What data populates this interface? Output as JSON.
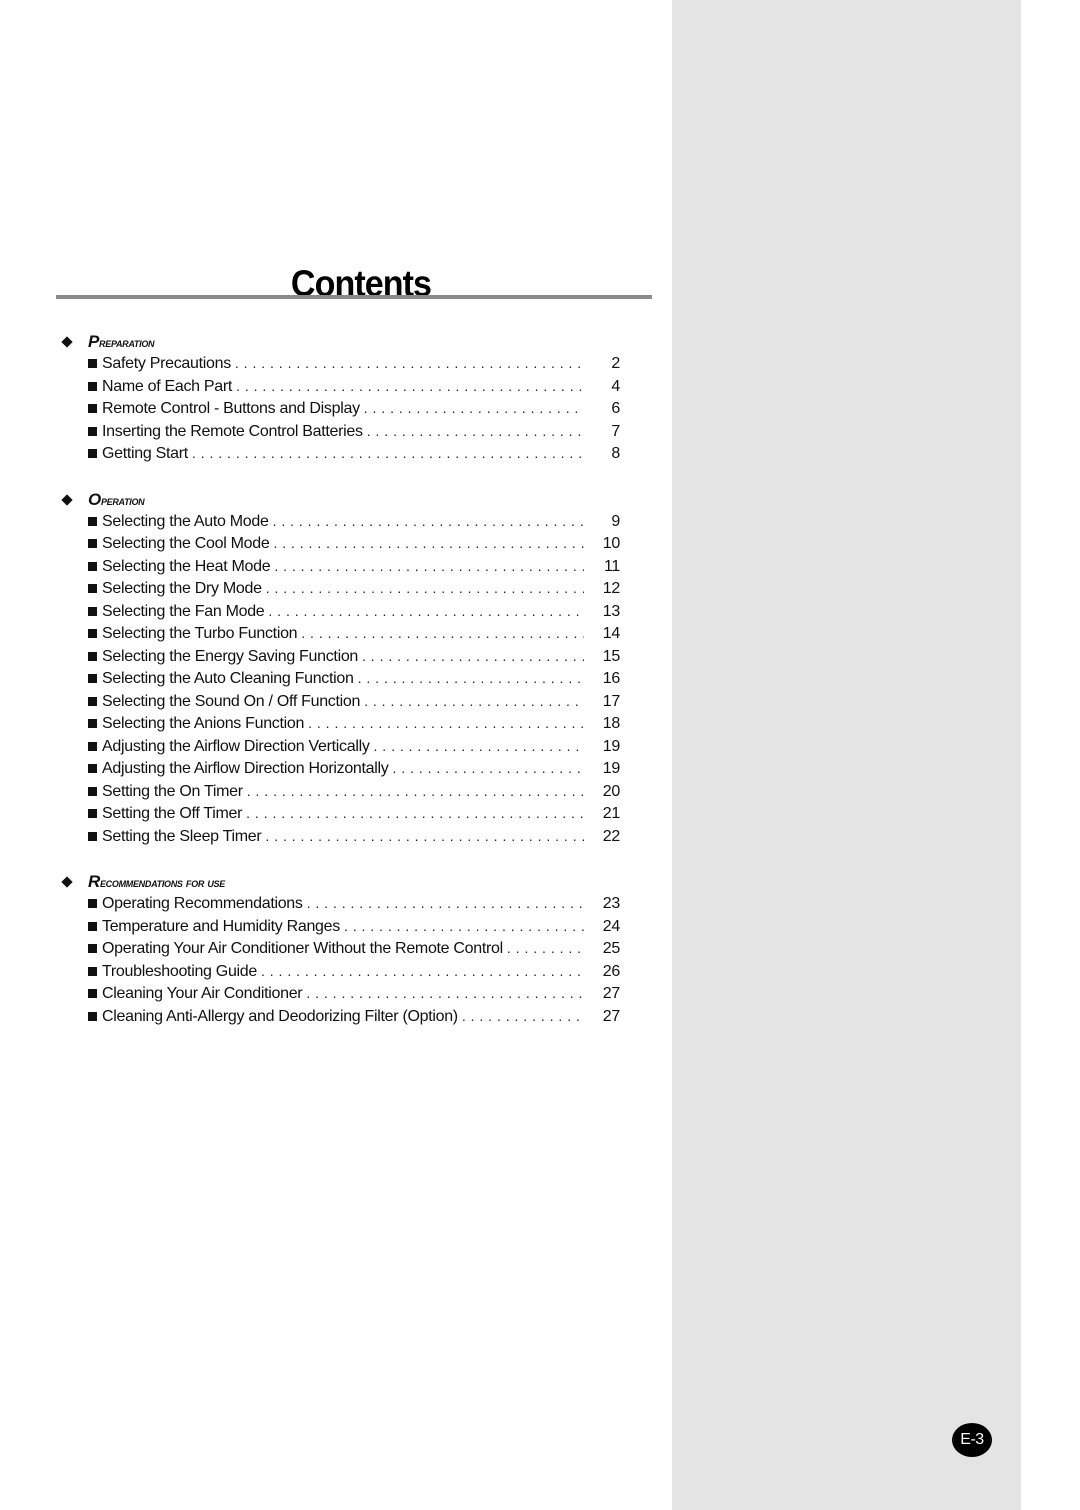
{
  "page": {
    "title": "Contents",
    "page_number": "E-3",
    "panel_color": "#e4e4e4",
    "rule_color": "#8a8a8a"
  },
  "sections": [
    {
      "label": "Preparation",
      "entries": [
        {
          "title": "Safety Precautions",
          "page": "2"
        },
        {
          "title": "Name of Each Part",
          "page": "4"
        },
        {
          "title": "Remote Control - Buttons and Display",
          "page": "6"
        },
        {
          "title": "Inserting the Remote Control Batteries",
          "page": "7"
        },
        {
          "title": "Getting Start",
          "page": "8"
        }
      ]
    },
    {
      "label": "Operation",
      "entries": [
        {
          "title": "Selecting the Auto Mode",
          "page": "9"
        },
        {
          "title": "Selecting the Cool Mode",
          "page": "10"
        },
        {
          "title": "Selecting the Heat Mode",
          "page": "11"
        },
        {
          "title": "Selecting the Dry Mode",
          "page": "12"
        },
        {
          "title": "Selecting the Fan Mode",
          "page": "13"
        },
        {
          "title": "Selecting the Turbo Function",
          "page": "14"
        },
        {
          "title": "Selecting the Energy Saving Function",
          "page": "15"
        },
        {
          "title": "Selecting the Auto Cleaning Function",
          "page": "16"
        },
        {
          "title": "Selecting the Sound On / Off Function",
          "page": "17"
        },
        {
          "title": "Selecting the Anions Function",
          "page": "18"
        },
        {
          "title": "Adjusting the Airflow Direction Vertically",
          "page": "19"
        },
        {
          "title": "Adjusting the Airflow Direction Horizontally",
          "page": "19"
        },
        {
          "title": "Setting the On Timer",
          "page": "20"
        },
        {
          "title": "Setting the Off Timer",
          "page": "21"
        },
        {
          "title": "Setting the Sleep Timer",
          "page": "22"
        }
      ]
    },
    {
      "label": "Recommendations for use",
      "entries": [
        {
          "title": "Operating Recommendations",
          "page": "23"
        },
        {
          "title": "Temperature and Humidity Ranges",
          "page": "24"
        },
        {
          "title": "Operating Your Air Conditioner Without the Remote Control",
          "page": "25"
        },
        {
          "title": "Troubleshooting Guide",
          "page": "26"
        },
        {
          "title": "Cleaning Your Air Conditioner",
          "page": "27"
        },
        {
          "title": "Cleaning Anti-Allergy and Deodorizing Filter (Option)",
          "page": "27"
        }
      ]
    }
  ]
}
